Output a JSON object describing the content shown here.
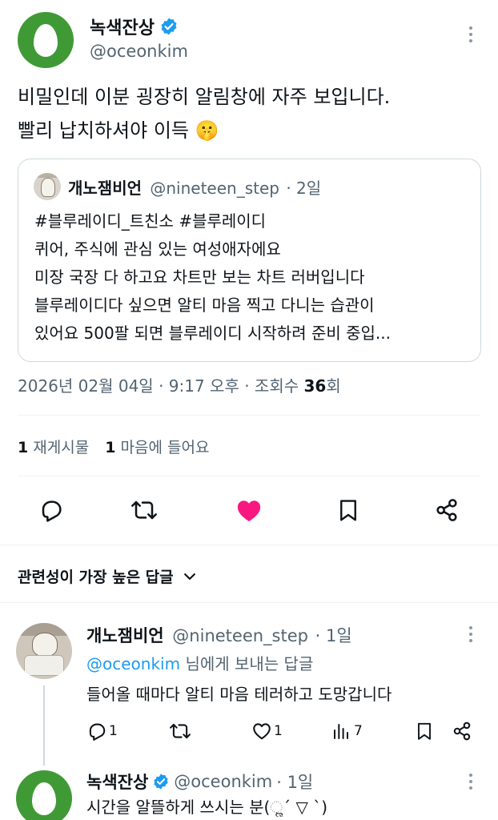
{
  "post": {
    "author_name": "녹색잔상",
    "author_handle": "@oceonkim",
    "text_line1": "비밀인데 이분 굉장히 알림창에 자주 보입니다.",
    "text_line2": "빨리 납치하셔야 이득",
    "emoji": "🤫",
    "timestamp": "2026년 02월 04일 · 9:17 오후 · 조회수",
    "views": "36",
    "views_suffix": "회"
  },
  "quoted": {
    "author_name": "개노잼비언",
    "author_handle": "@nineteen_step",
    "time": "· 2일",
    "lines": [
      "#블루레이디_트친소 #블루레이디",
      "퀴어, 주식에 관심 있는 여성애자에요",
      "미장 국장 다 하고요 차트만 보는 차트 러버입니다",
      "블루레이디다 싶으면 알티 마음 찍고 다니는 습관이",
      "있어요 500팔 되면 블루레이디 시작하려 준비 중입..."
    ]
  },
  "stats": {
    "reposts_count": "1",
    "reposts_label": "재게시물",
    "likes_count": "1",
    "likes_label": "마음에 들어요"
  },
  "actions": {
    "reply_icon": "reply-icon",
    "repost_icon": "repost-icon",
    "like_icon": "heart-icon",
    "bookmark_icon": "bookmark-icon",
    "share_icon": "share-icon",
    "like_color": "#f91880"
  },
  "sort": {
    "label": "관련성이 가장 높은 답글"
  },
  "replies": [
    {
      "author_name": "개노잼비언",
      "author_handle": "@nineteen_step",
      "time": "· 1일",
      "mention": "@oceonkim",
      "mention_suffix": "님에게 보내는 답글",
      "text": "들어올 때마다 알티 마음 테러하고 도망갑니다",
      "reply_count": "1",
      "like_count": "1",
      "views": "7"
    },
    {
      "author_name": "녹색잔상",
      "author_handle": "@oceonkim",
      "time": "· 1일",
      "text": "시간을 알뜰하게 쓰시는 분(ૢ´ ▽ `)"
    }
  ],
  "colors": {
    "accent": "#1d9bf0",
    "avatar_green": "#3f9a36",
    "text_primary": "#0f1419",
    "text_muted": "#536471"
  }
}
